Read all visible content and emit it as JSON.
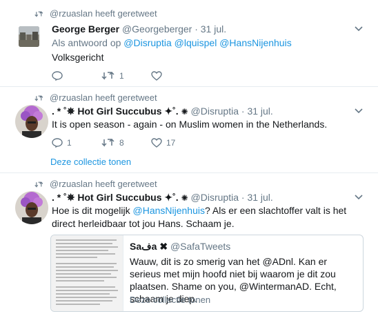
{
  "tweets": [
    {
      "context": "@rzuaslan heeft geretweet",
      "name": "George Berger",
      "handle": "@Georgeberger",
      "time": "· 31 jul.",
      "reply_prefix": "Als antwoord op",
      "reply_to": [
        "@Disruptia",
        "@lquispel",
        "@HansNijenhuis"
      ],
      "text": "Volksgericht",
      "retweets": "1",
      "likes": ""
    },
    {
      "context": "@rzuaslan heeft geretweet",
      "name": ". * ˚✵ Hot Girl Succubus ✦˚.",
      "handle": "@Disruptia",
      "time": "· 31 jul.",
      "text": "It is open season - again - on Muslim women in the Netherlands.",
      "replies": "1",
      "retweets": "8",
      "likes": "17",
      "collection": "Deze collectie tonen"
    },
    {
      "context": "@rzuaslan heeft geretweet",
      "name": ". * ˚✵ Hot Girl Succubus ✦˚.",
      "handle": "@Disruptia",
      "time": "· 31 jul.",
      "text_before": "Hoe is dit mogelijk",
      "mention": "@HansNijenhuis",
      "text_after": "?  Als er een slachtoffer valt is het direct herleidbaar tot jou Hans. Schaam je.",
      "quote": {
        "name": "Saفa ✖",
        "handle": "@SafaTweets",
        "text": "Wauw, dit is zo smerig van het @ADnl. Kan er serieus met mijn hoofd niet bij waarom je dit zou plaatsen. Shame on you, @WintermanAD. Echt, schaam je diep.",
        "collection": "Deze collectie tonen"
      }
    }
  ],
  "colors": {
    "link": "#1b95e0",
    "muted": "#657786",
    "text": "#14171a",
    "border": "#e6ecf0"
  }
}
